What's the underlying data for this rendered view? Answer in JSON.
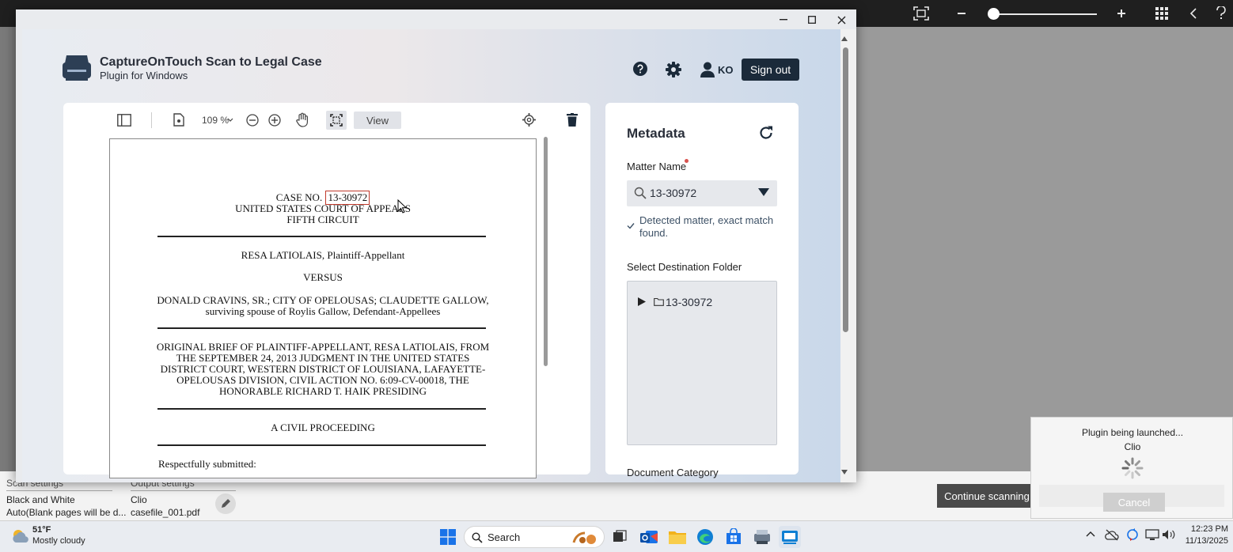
{
  "background_toolbar": {
    "icons": [
      "fit-screen-icon",
      "zoom-out-icon",
      "zoom-slider",
      "zoom-in-icon",
      "apps-grid-icon",
      "back-icon",
      "help-icon"
    ]
  },
  "scan_settings": {
    "header": "Scan settings",
    "color_mode": "Black and White",
    "blank_pages": "Auto(Blank pages will be d..."
  },
  "output_settings": {
    "header": "Output settings",
    "destination": "Clio",
    "filename": "casefile_001.pdf"
  },
  "footer_buttons": {
    "continue_label": "Continue scanning"
  },
  "plugin_toast": {
    "message": "Plugin being launched...",
    "app": "Clio",
    "cancel_label": "Cancel"
  },
  "app": {
    "title": "CaptureOnTouch Scan to Legal Case",
    "subtitle": "Plugin for Windows",
    "user_initials": "KO",
    "sign_out_label": "Sign out"
  },
  "viewer": {
    "zoom": "109 %",
    "view_label": "View"
  },
  "document": {
    "case_no_label": "CASE NO.",
    "case_no": "13-30972",
    "court": "UNITED STATES COURT OF APPEALS",
    "circuit": "FIFTH CIRCUIT",
    "plaintiff": "RESA LATIOLAIS, Plaintiff-Appellant",
    "versus": "VERSUS",
    "defendants_1": "DONALD CRAVINS, SR.; CITY OF OPELOUSAS; CLAUDETTE GALLOW,",
    "defendants_2": "surviving spouse of Roylis Gallow, Defendant-Appellees",
    "brief_1": "ORIGINAL BRIEF OF PLAINTIFF-APPELLANT, RESA LATIOLAIS, FROM",
    "brief_2": "THE SEPTEMBER 24, 2013 JUDGMENT IN THE UNITED STATES",
    "brief_3": "DISTRICT COURT, WESTERN DISTRICT OF LOUISIANA, LAFAYETTE-",
    "brief_4": "OPELOUSAS DIVISION, CIVIL ACTION NO. 6:09-CV-00018, THE",
    "brief_5": "HONORABLE RICHARD T. HAIK PRESIDING",
    "proceeding": "A CIVIL PROCEEDING",
    "submitted": "Respectfully submitted:"
  },
  "metadata": {
    "title": "Metadata",
    "matter_label": "Matter Name",
    "matter_value": "13-30972",
    "detected_msg_1": "Detected matter, exact match",
    "detected_msg_2": "found.",
    "folder_label": "Select Destination Folder",
    "folder_item": "13-30972",
    "category_label": "Document Category"
  },
  "taskbar": {
    "weather_temp": "51°F",
    "weather_desc": "Mostly cloudy",
    "search_label": "Search",
    "time": "12:23 PM",
    "date": "11/13/2025"
  },
  "colors": {
    "dark_navy": "#1b2a3a",
    "required_mark": "#d9534f",
    "highlight_box": "#c0392b",
    "detected_text": "#3d5166"
  }
}
